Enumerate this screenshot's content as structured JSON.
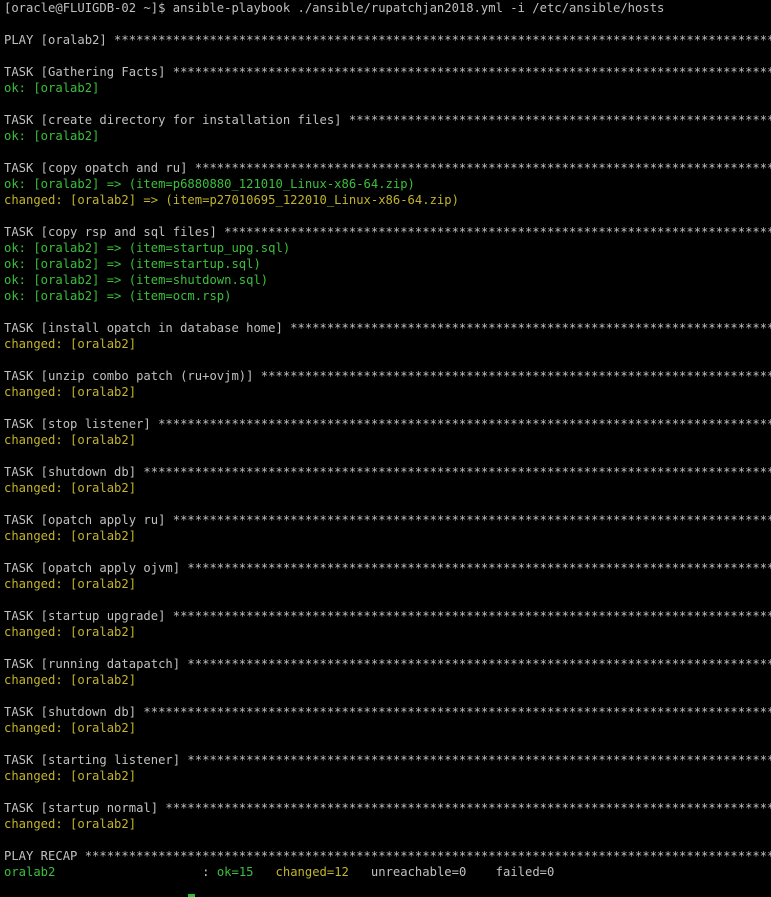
{
  "terminal": {
    "colors": {
      "background": "#000000",
      "default": "#c0c0c0",
      "ok": "#3cbf3c",
      "changed": "#c2b42c"
    },
    "lines": [
      {
        "kind": "prompt",
        "segments": [
          {
            "text": "[oracle@FLUIGDB-02 ~]$ ansible-playbook ./ansible/rupatchjan2018.yml -i /etc/ansible/hosts",
            "color": "default"
          }
        ]
      },
      {
        "kind": "blank",
        "segments": []
      },
      {
        "kind": "play",
        "segments": [
          {
            "text": "PLAY [oralab2] ******************************************************************************************************",
            "color": "default"
          }
        ]
      },
      {
        "kind": "blank",
        "segments": []
      },
      {
        "kind": "task",
        "segments": [
          {
            "text": "TASK [Gathering Facts] **********************************************************************************************",
            "color": "default"
          }
        ]
      },
      {
        "kind": "result",
        "segments": [
          {
            "text": "ok: [oralab2]",
            "color": "ok"
          }
        ]
      },
      {
        "kind": "blank",
        "segments": []
      },
      {
        "kind": "task",
        "segments": [
          {
            "text": "TASK [create directory for installation files] ******************************************************************",
            "color": "default"
          }
        ]
      },
      {
        "kind": "result",
        "segments": [
          {
            "text": "ok: [oralab2]",
            "color": "ok"
          }
        ]
      },
      {
        "kind": "blank",
        "segments": []
      },
      {
        "kind": "task",
        "segments": [
          {
            "text": "TASK [copy opatch and ru] *******************************************************************************************",
            "color": "default"
          }
        ]
      },
      {
        "kind": "result",
        "segments": [
          {
            "text": "ok: [oralab2] => (item=p6880880_121010_Linux-x86-64.zip)",
            "color": "ok"
          }
        ]
      },
      {
        "kind": "result",
        "segments": [
          {
            "text": "changed: [oralab2] => (item=p27010695_122010_Linux-x86-64.zip)",
            "color": "changed"
          }
        ]
      },
      {
        "kind": "blank",
        "segments": []
      },
      {
        "kind": "task",
        "segments": [
          {
            "text": "TASK [copy rsp and sql files] ***************************************************************************************",
            "color": "default"
          }
        ]
      },
      {
        "kind": "result",
        "segments": [
          {
            "text": "ok: [oralab2] => (item=startup_upg.sql)",
            "color": "ok"
          }
        ]
      },
      {
        "kind": "result",
        "segments": [
          {
            "text": "ok: [oralab2] => (item=startup.sql)",
            "color": "ok"
          }
        ]
      },
      {
        "kind": "result",
        "segments": [
          {
            "text": "ok: [oralab2] => (item=shutdown.sql)",
            "color": "ok"
          }
        ]
      },
      {
        "kind": "result",
        "segments": [
          {
            "text": "ok: [oralab2] => (item=ocm.rsp)",
            "color": "ok"
          }
        ]
      },
      {
        "kind": "blank",
        "segments": []
      },
      {
        "kind": "task",
        "segments": [
          {
            "text": "TASK [install opatch in database home] **************************************************************************",
            "color": "default"
          }
        ]
      },
      {
        "kind": "result",
        "segments": [
          {
            "text": "changed: [oralab2]",
            "color": "changed"
          }
        ]
      },
      {
        "kind": "blank",
        "segments": []
      },
      {
        "kind": "task",
        "segments": [
          {
            "text": "TASK [unzip combo patch (ru+ovjm)] ******************************************************************************",
            "color": "default"
          }
        ]
      },
      {
        "kind": "result",
        "segments": [
          {
            "text": "changed: [oralab2]",
            "color": "changed"
          }
        ]
      },
      {
        "kind": "blank",
        "segments": []
      },
      {
        "kind": "task",
        "segments": [
          {
            "text": "TASK [stop listener] ************************************************************************************************",
            "color": "default"
          }
        ]
      },
      {
        "kind": "result",
        "segments": [
          {
            "text": "changed: [oralab2]",
            "color": "changed"
          }
        ]
      },
      {
        "kind": "blank",
        "segments": []
      },
      {
        "kind": "task",
        "segments": [
          {
            "text": "TASK [shutdown db] **************************************************************************************************",
            "color": "default"
          }
        ]
      },
      {
        "kind": "result",
        "segments": [
          {
            "text": "changed: [oralab2]",
            "color": "changed"
          }
        ]
      },
      {
        "kind": "blank",
        "segments": []
      },
      {
        "kind": "task",
        "segments": [
          {
            "text": "TASK [opatch apply ru] **********************************************************************************************",
            "color": "default"
          }
        ]
      },
      {
        "kind": "result",
        "segments": [
          {
            "text": "changed: [oralab2]",
            "color": "changed"
          }
        ]
      },
      {
        "kind": "blank",
        "segments": []
      },
      {
        "kind": "task",
        "segments": [
          {
            "text": "TASK [opatch apply ojvm] ********************************************************************************************",
            "color": "default"
          }
        ]
      },
      {
        "kind": "result",
        "segments": [
          {
            "text": "changed: [oralab2]",
            "color": "changed"
          }
        ]
      },
      {
        "kind": "blank",
        "segments": []
      },
      {
        "kind": "task",
        "segments": [
          {
            "text": "TASK [startup upgrade] **********************************************************************************************",
            "color": "default"
          }
        ]
      },
      {
        "kind": "result",
        "segments": [
          {
            "text": "changed: [oralab2]",
            "color": "changed"
          }
        ]
      },
      {
        "kind": "blank",
        "segments": []
      },
      {
        "kind": "task",
        "segments": [
          {
            "text": "TASK [running datapatch] ********************************************************************************************",
            "color": "default"
          }
        ]
      },
      {
        "kind": "result",
        "segments": [
          {
            "text": "changed: [oralab2]",
            "color": "changed"
          }
        ]
      },
      {
        "kind": "blank",
        "segments": []
      },
      {
        "kind": "task",
        "segments": [
          {
            "text": "TASK [shutdown db] **************************************************************************************************",
            "color": "default"
          }
        ]
      },
      {
        "kind": "result",
        "segments": [
          {
            "text": "changed: [oralab2]",
            "color": "changed"
          }
        ]
      },
      {
        "kind": "blank",
        "segments": []
      },
      {
        "kind": "task",
        "segments": [
          {
            "text": "TASK [starting listener] ********************************************************************************************",
            "color": "default"
          }
        ]
      },
      {
        "kind": "result",
        "segments": [
          {
            "text": "changed: [oralab2]",
            "color": "changed"
          }
        ]
      },
      {
        "kind": "blank",
        "segments": []
      },
      {
        "kind": "task",
        "segments": [
          {
            "text": "TASK [startup normal] ***********************************************************************************************",
            "color": "default"
          }
        ]
      },
      {
        "kind": "result",
        "segments": [
          {
            "text": "changed: [oralab2]",
            "color": "changed"
          }
        ]
      },
      {
        "kind": "blank",
        "segments": []
      },
      {
        "kind": "recap",
        "segments": [
          {
            "text": "PLAY RECAP **********************************************************************************************************",
            "color": "default"
          }
        ]
      },
      {
        "kind": "recap-row",
        "segments": [
          {
            "text": "oralab2",
            "color": "ok"
          },
          {
            "text": "                    : ",
            "color": "default"
          },
          {
            "text": "ok=15",
            "color": "ok"
          },
          {
            "text": "   ",
            "color": "default"
          },
          {
            "text": "changed=12",
            "color": "changed"
          },
          {
            "text": "   unreachable=0    failed=0",
            "color": "default"
          }
        ]
      }
    ]
  }
}
